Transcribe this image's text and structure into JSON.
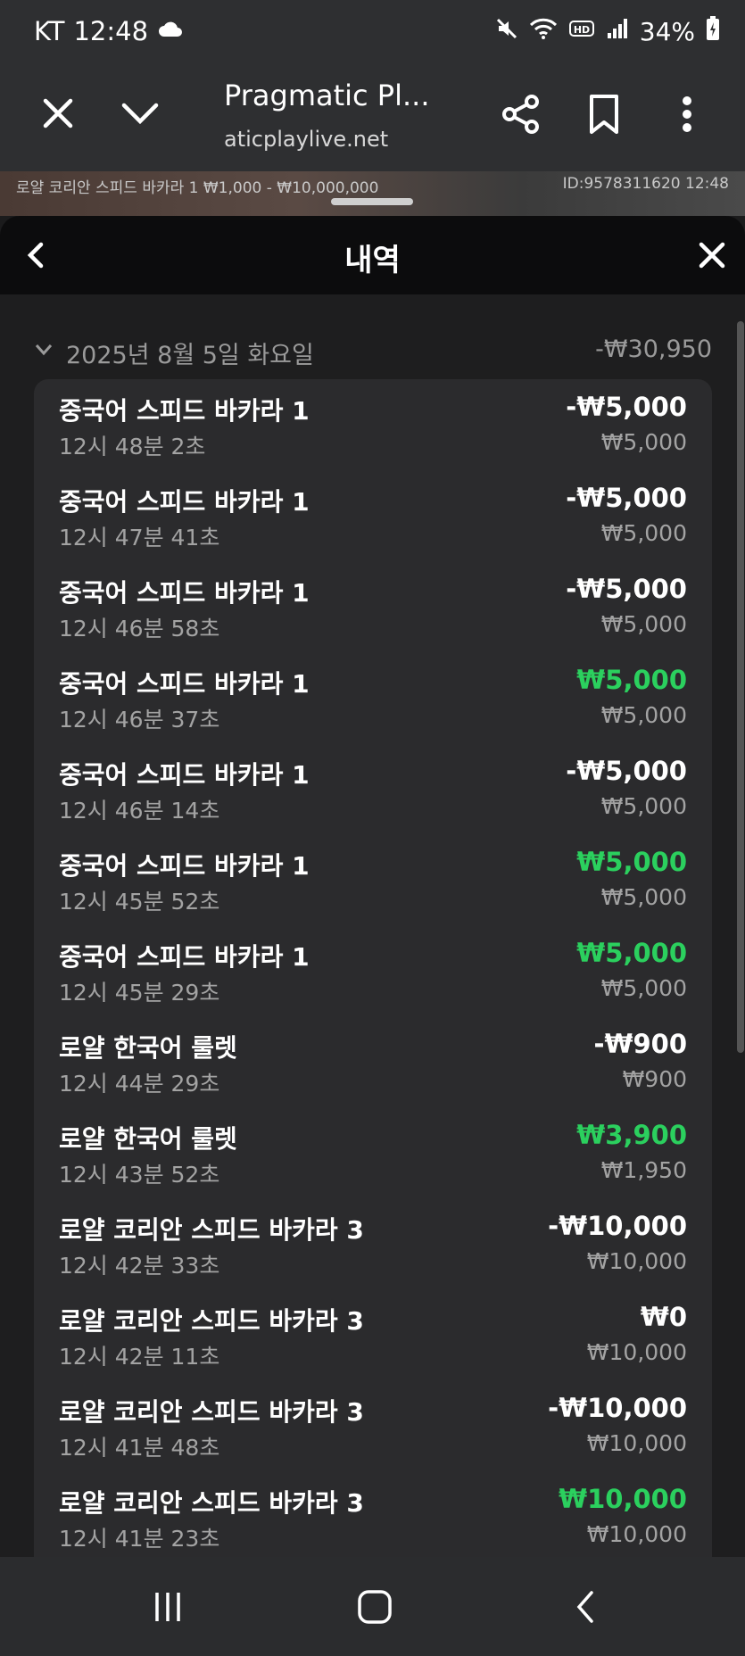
{
  "status_bar": {
    "carrier": "KT",
    "time": "12:48",
    "battery": "34%",
    "icons": [
      "cloud-icon",
      "mute-icon",
      "wifi-icon",
      "hd-icon",
      "signal-icon",
      "battery-icon"
    ]
  },
  "browser": {
    "title": "Pragmatic Pl...",
    "url": "aticplaylive.net",
    "icons": [
      "close-icon",
      "chevron-down-icon",
      "share-icon",
      "bookmark-icon",
      "more-icon"
    ]
  },
  "video_strip": {
    "info": "로얄 코리안 스피드 바카라 1  ₩1,000 - ₩10,000,000",
    "id": "ID:9578311620  12:48"
  },
  "modal": {
    "title": "내역",
    "icons": [
      "back-icon",
      "close-icon"
    ]
  },
  "history": {
    "date": "2025년 8월 5일 화요일",
    "total": "-₩30,950",
    "rows": [
      {
        "game": "중국어 스피드 바카라 1",
        "time": "12시 48분 2초",
        "amount": "-₩5,000",
        "bet": "₩5,000",
        "win": false
      },
      {
        "game": "중국어 스피드 바카라 1",
        "time": "12시 47분 41초",
        "amount": "-₩5,000",
        "bet": "₩5,000",
        "win": false
      },
      {
        "game": "중국어 스피드 바카라 1",
        "time": "12시 46분 58초",
        "amount": "-₩5,000",
        "bet": "₩5,000",
        "win": false
      },
      {
        "game": "중국어 스피드 바카라 1",
        "time": "12시 46분 37초",
        "amount": "₩5,000",
        "bet": "₩5,000",
        "win": true
      },
      {
        "game": "중국어 스피드 바카라 1",
        "time": "12시 46분 14초",
        "amount": "-₩5,000",
        "bet": "₩5,000",
        "win": false
      },
      {
        "game": "중국어 스피드 바카라 1",
        "time": "12시 45분 52초",
        "amount": "₩5,000",
        "bet": "₩5,000",
        "win": true
      },
      {
        "game": "중국어 스피드 바카라 1",
        "time": "12시 45분 29초",
        "amount": "₩5,000",
        "bet": "₩5,000",
        "win": true
      },
      {
        "game": "로얄 한국어 룰렛",
        "time": "12시 44분 29초",
        "amount": "-₩900",
        "bet": "₩900",
        "win": false
      },
      {
        "game": "로얄 한국어 룰렛",
        "time": "12시 43분 52초",
        "amount": "₩3,900",
        "bet": "₩1,950",
        "win": true
      },
      {
        "game": "로얄 코리안 스피드 바카라 3",
        "time": "12시 42분 33초",
        "amount": "-₩10,000",
        "bet": "₩10,000",
        "win": false
      },
      {
        "game": "로얄 코리안 스피드 바카라 3",
        "time": "12시 42분 11초",
        "amount": "₩0",
        "bet": "₩10,000",
        "win": false
      },
      {
        "game": "로얄 코리안 스피드 바카라 3",
        "time": "12시 41분 48초",
        "amount": "-₩10,000",
        "bet": "₩10,000",
        "win": false
      },
      {
        "game": "로얄 코리안 스피드 바카라 3",
        "time": "12시 41분 23초",
        "amount": "₩10,000",
        "bet": "₩10,000",
        "win": true
      }
    ]
  },
  "nav_bar": {
    "icons": [
      "recent-apps-icon",
      "home-icon",
      "back-icon"
    ]
  },
  "colors": {
    "win": "#2bd05e",
    "background": "#1e1e1f",
    "card": "#2b2b2d"
  }
}
